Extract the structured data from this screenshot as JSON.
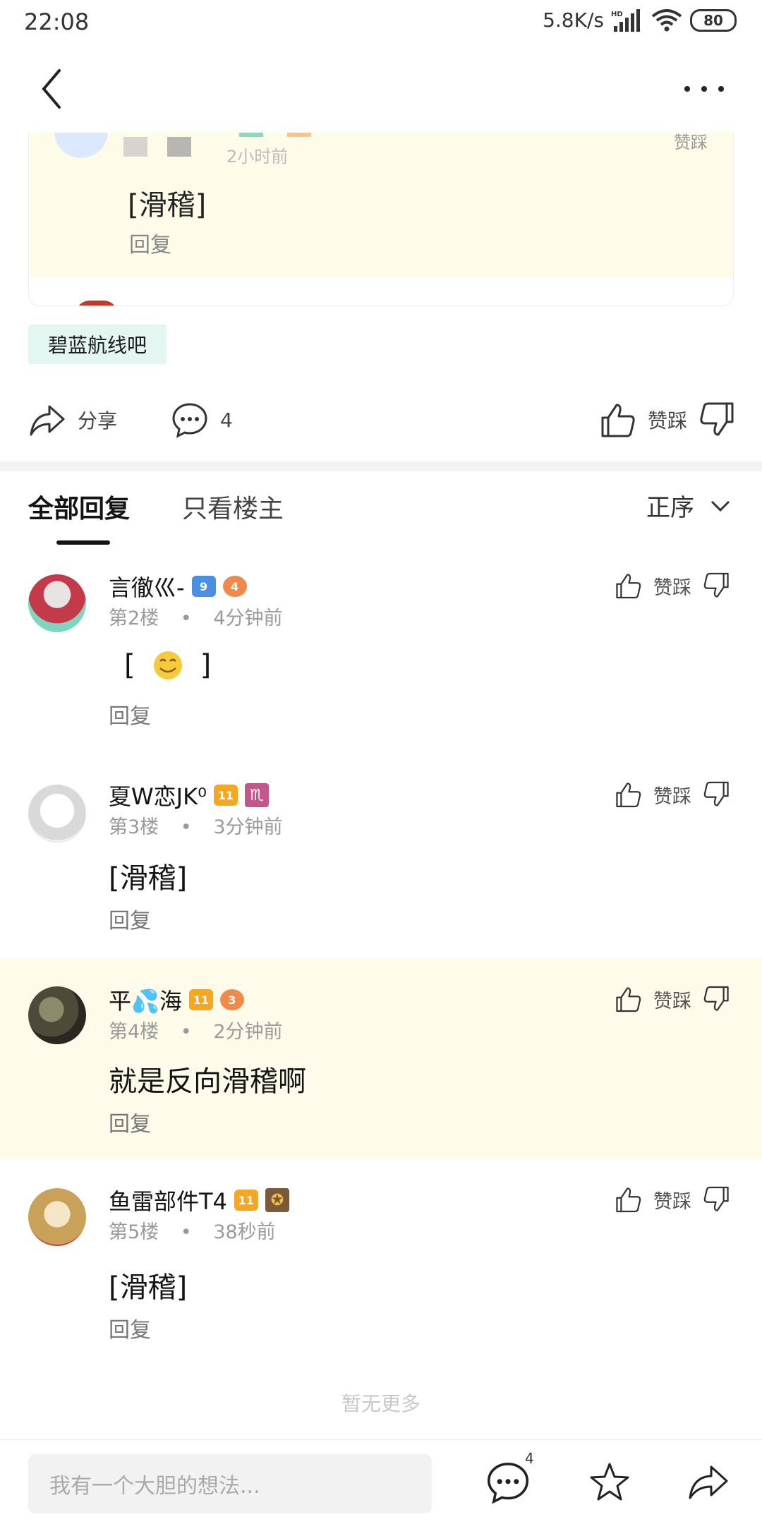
{
  "status": {
    "time": "22:08",
    "speed": "5.8K/s",
    "battery": "80"
  },
  "quoted": {
    "text": "[滑稽]",
    "reply_label": "回复",
    "meta": "2小时前",
    "like_label": "赞踩"
  },
  "forum_tag": "碧蓝航线吧",
  "actions": {
    "share_label": "分享",
    "comment_count": "4",
    "vote_label": "赞踩"
  },
  "tabs": {
    "all": "全部回复",
    "op_only": "只看楼主",
    "sort": "正序"
  },
  "replies": [
    {
      "name": "言徹巛-",
      "badge1": "9",
      "badge2": "4",
      "floor": "第2楼",
      "time": "4分钟前",
      "content_pre": "[",
      "content_post": "]",
      "reply_label": "回复",
      "vote_label": "赞踩"
    },
    {
      "name": "夏W恋JK⁰",
      "badge1": "11",
      "badge2": "♏",
      "floor": "第3楼",
      "time": "3分钟前",
      "content": "[滑稽]",
      "reply_label": "回复",
      "vote_label": "赞踩"
    },
    {
      "name": "平💦海",
      "badge1": "11",
      "badge2": "3",
      "floor": "第4楼",
      "time": "2分钟前",
      "content": "就是反向滑稽啊",
      "reply_label": "回复",
      "vote_label": "赞踩"
    },
    {
      "name": "鱼雷部件T4",
      "badge1": "11",
      "badge2": "✪",
      "floor": "第5楼",
      "time": "38秒前",
      "content": "[滑稽]",
      "reply_label": "回复",
      "vote_label": "赞踩"
    }
  ],
  "dot_separator": "•",
  "no_more": "暂无更多",
  "bottom": {
    "placeholder": "我有一个大胆的想法...",
    "comment_count": "4"
  },
  "colors": {
    "highlight_bg": "#fefbea",
    "quote_bg": "#fefce8",
    "forum_tag_bg": "#e3f6f1",
    "badge_gold": "#f5a623",
    "badge_blue": "#4a90e2",
    "badge_pink": "#c2578b"
  }
}
